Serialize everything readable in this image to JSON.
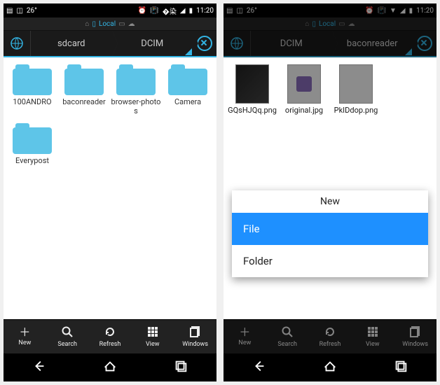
{
  "status": {
    "temp": "26°",
    "time": "11:20"
  },
  "local_bar": {
    "label": "Local"
  },
  "left": {
    "path": [
      "sdcard",
      "DCIM"
    ],
    "items": [
      {
        "label": "100ANDRO",
        "type": "folder"
      },
      {
        "label": "baconreader",
        "type": "folder"
      },
      {
        "label": "browser-photos",
        "type": "folder"
      },
      {
        "label": "Camera",
        "type": "folder"
      },
      {
        "label": "Everypost",
        "type": "folder"
      }
    ]
  },
  "right": {
    "path": [
      "DCIM",
      "baconreader"
    ],
    "items": [
      {
        "label": "GQsHJQq.png",
        "type": "file"
      },
      {
        "label": "original.jpg",
        "type": "file"
      },
      {
        "label": "PkIDdop.png",
        "type": "file"
      }
    ],
    "dialog": {
      "title": "New",
      "options": [
        {
          "label": "File",
          "selected": true
        },
        {
          "label": "Folder",
          "selected": false
        }
      ]
    }
  },
  "toolbar": [
    {
      "label": "New",
      "icon": "+"
    },
    {
      "label": "Search",
      "icon": "search"
    },
    {
      "label": "Refresh",
      "icon": "refresh"
    },
    {
      "label": "View",
      "icon": "grid"
    },
    {
      "label": "Windows",
      "icon": "windows"
    }
  ]
}
